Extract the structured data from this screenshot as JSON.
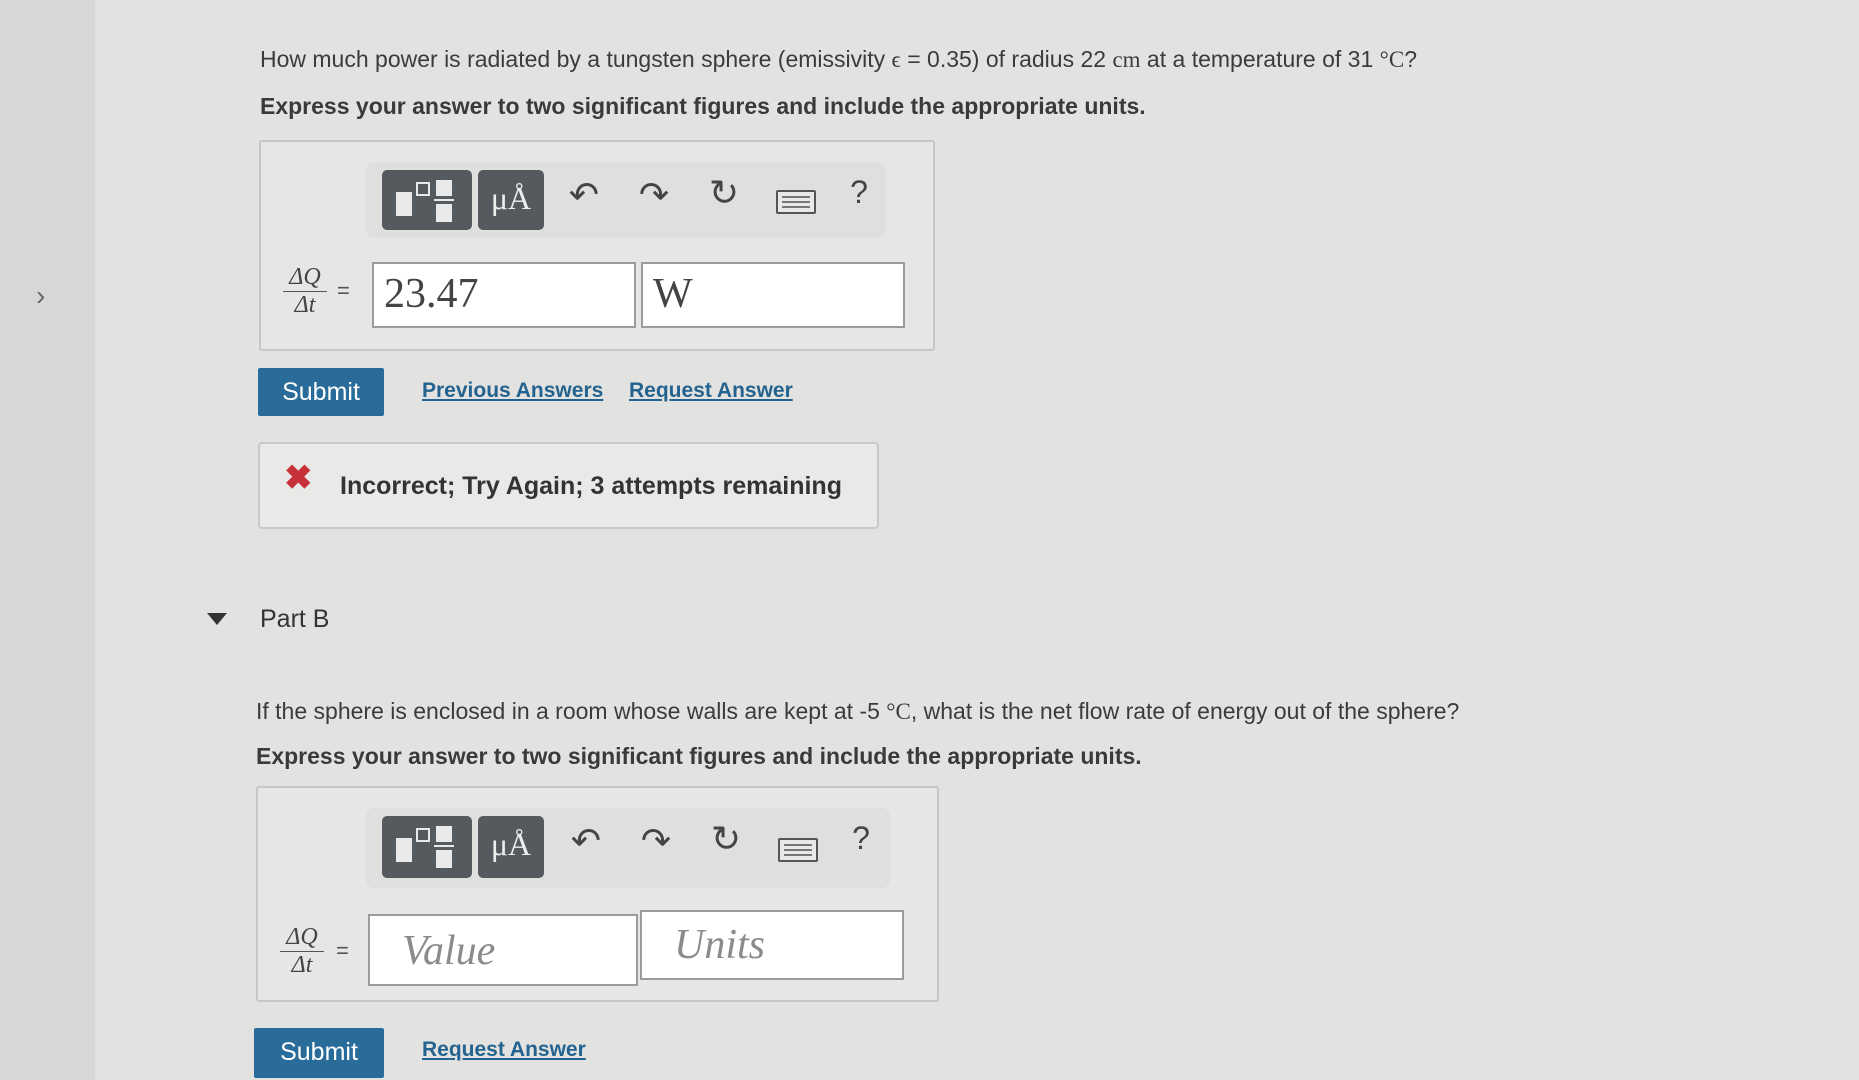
{
  "partA": {
    "question": {
      "pre": "How much power is radiated by a tungsten sphere (emissivity ",
      "epsilon_symbol": "ϵ",
      "mid": " = 0.35) of radius 22 ",
      "unit_cm": "cm",
      "post": " at a temperature of 31 ",
      "unit_degC": "°C",
      "end": "?"
    },
    "instruction": "Express your answer to two significant figures and include the appropriate units.",
    "toolbar": {
      "mu_label": "μÅ",
      "help_label": "?"
    },
    "lhs": {
      "numerator": "ΔQ",
      "denominator": "Δt",
      "equals": "="
    },
    "value": "23.47",
    "units": "W",
    "submit_label": "Submit",
    "links": {
      "previous_answers": "Previous Answers",
      "request_answer": "Request Answer"
    },
    "feedback": "Incorrect; Try Again; 3 attempts remaining"
  },
  "partB": {
    "heading": "Part B",
    "question": {
      "pre": "If the sphere is enclosed in a room whose walls are kept at -5 ",
      "unit_degC": "°C",
      "post": ", what is the net flow rate of energy out of the sphere?"
    },
    "instruction": "Express your answer to two significant figures and include the appropriate units.",
    "toolbar": {
      "mu_label": "μÅ",
      "help_label": "?"
    },
    "lhs": {
      "numerator": "ΔQ",
      "denominator": "Δt",
      "equals": "="
    },
    "value_placeholder": "Value",
    "units_placeholder": "Units",
    "submit_label": "Submit",
    "links": {
      "request_answer": "Request Answer"
    }
  },
  "colors": {
    "submit": "#2a6c99",
    "link": "#24638f",
    "error": "#c8313a"
  }
}
